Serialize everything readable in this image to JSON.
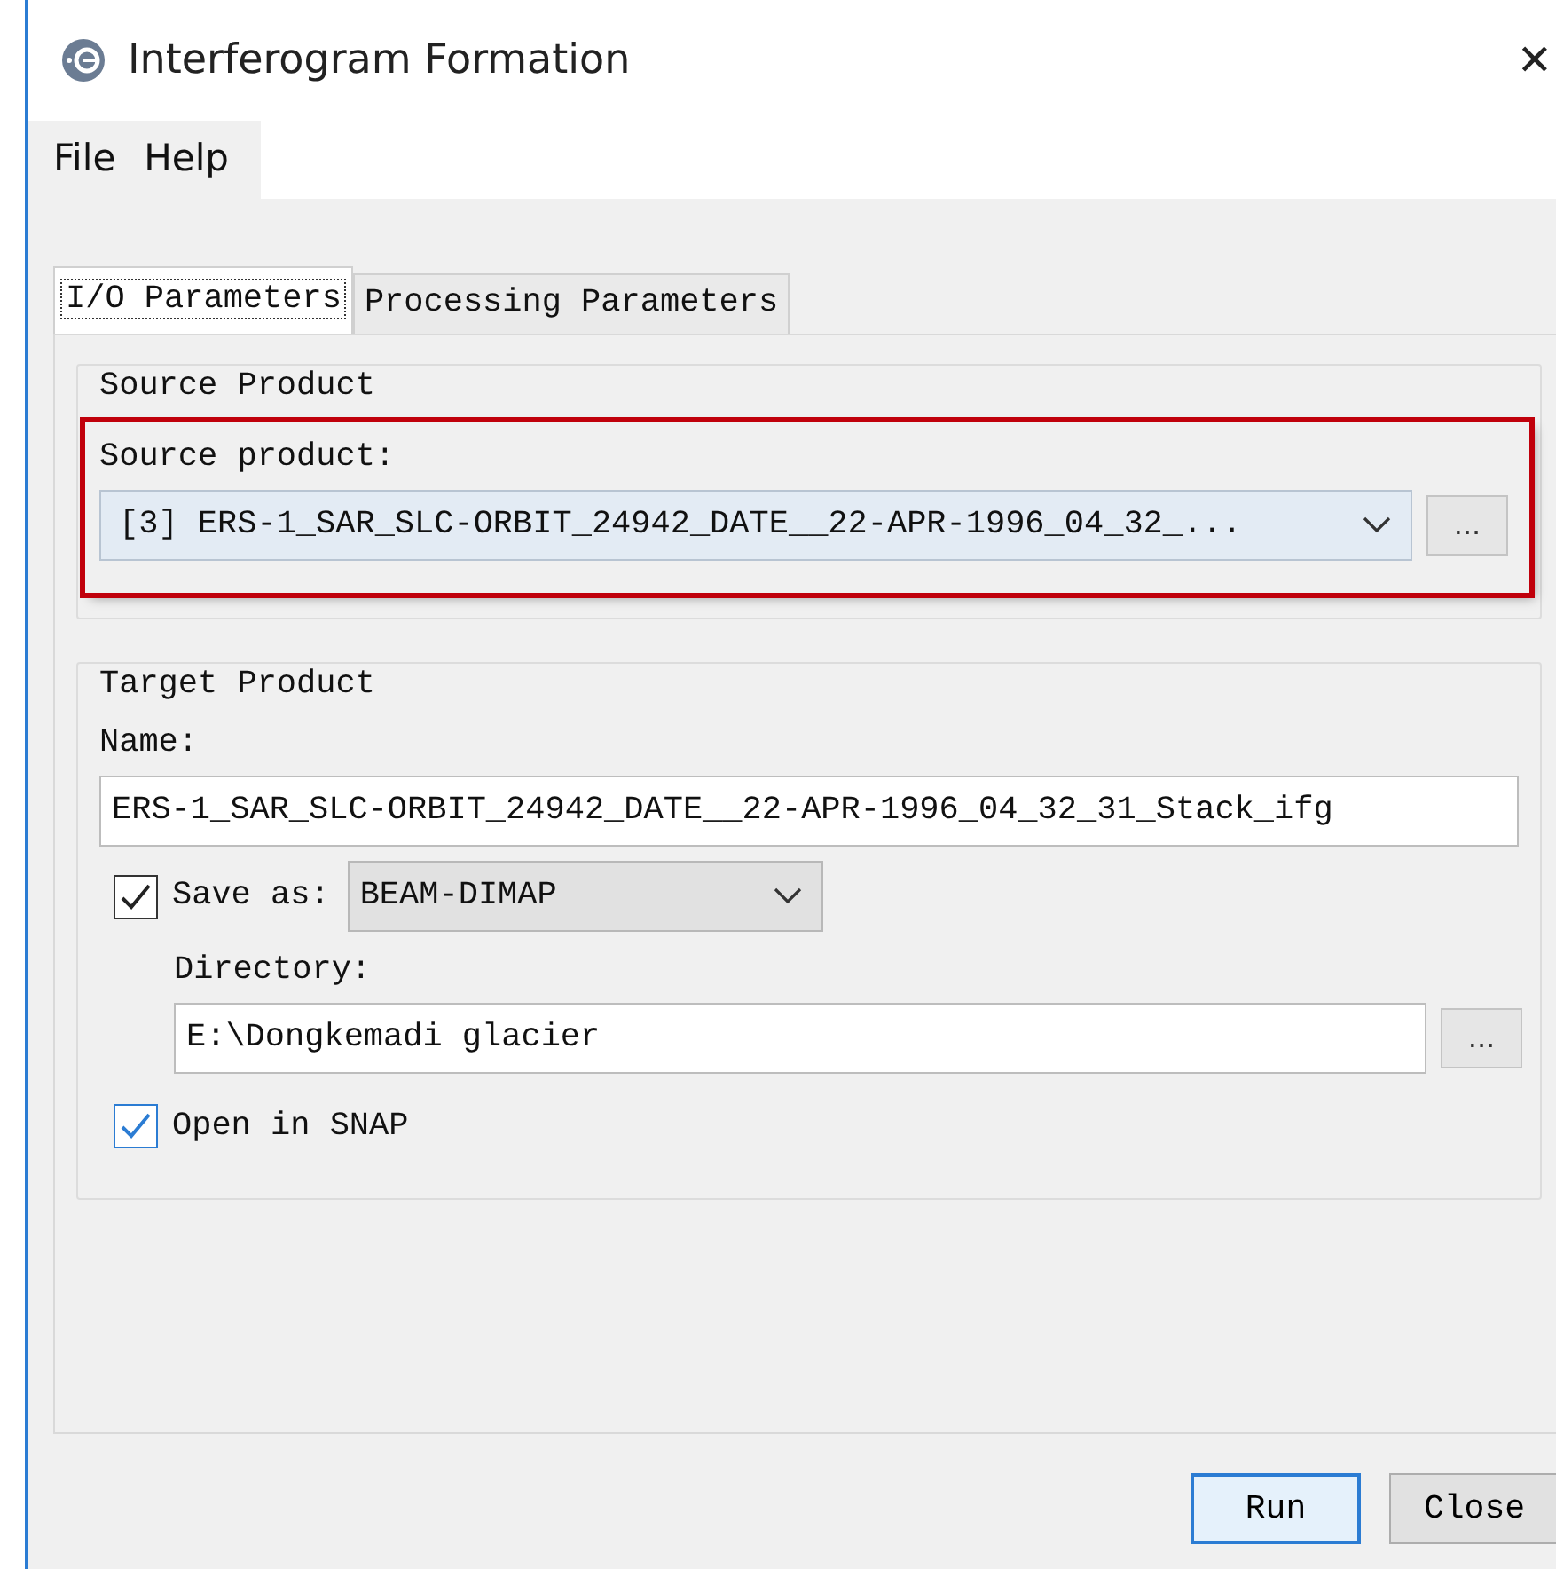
{
  "window": {
    "title": "Interferogram Formation",
    "close": "✕"
  },
  "menu": [
    "File",
    "Help"
  ],
  "tabs": [
    {
      "label": "I/O Parameters",
      "selected": true
    },
    {
      "label": "Processing Parameters",
      "selected": false
    }
  ],
  "source_group": {
    "title": "Source Product",
    "label": "Source product:",
    "value": "[3] ERS-1_SAR_SLC-ORBIT_24942_DATE__22-APR-1996_04_32_...",
    "browse": "...",
    "highlighted": true
  },
  "target_group": {
    "title": "Target Product",
    "name_label": "Name:",
    "name_value": "ERS-1_SAR_SLC-ORBIT_24942_DATE__22-APR-1996_04_32_31_Stack_ifg",
    "save_as": {
      "label": "Save as:",
      "checked": true,
      "format": "BEAM-DIMAP"
    },
    "directory_label": "Directory:",
    "directory_value": "E:\\Dongkemadi glacier",
    "browse": "...",
    "open_in": {
      "label": "Open in SNAP",
      "checked": true,
      "focused": true
    }
  },
  "buttons": [
    {
      "label": "Run",
      "default": true
    },
    {
      "label": "Close",
      "default": false
    }
  ]
}
